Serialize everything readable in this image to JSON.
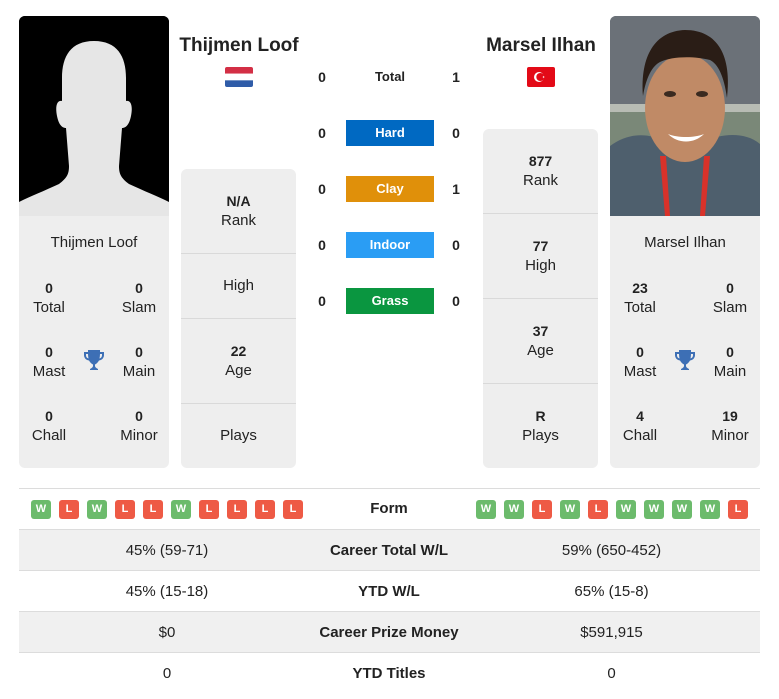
{
  "colors": {
    "hard": "#0069c2",
    "clay": "#e0900a",
    "indoor": "#2a9df4",
    "grass": "#0a9640",
    "win": "#6cbb6c",
    "loss": "#ee5a45",
    "trophy": "#3d6fb5"
  },
  "player1": {
    "name": "Thijmen Loof",
    "country_flag": "netherlands-flag",
    "photo": "silhouette-placeholder",
    "titles": {
      "total": {
        "value": "0",
        "label": "Total"
      },
      "slam": {
        "value": "0",
        "label": "Slam"
      },
      "mast": {
        "value": "0",
        "label": "Mast"
      },
      "main": {
        "value": "0",
        "label": "Main"
      },
      "chall": {
        "value": "0",
        "label": "Chall"
      },
      "minor": {
        "value": "0",
        "label": "Minor"
      }
    },
    "stats": [
      {
        "value": "N/A",
        "label": "Rank"
      },
      {
        "value": "",
        "label": "High"
      },
      {
        "value": "22",
        "label": "Age"
      },
      {
        "value": "",
        "label": "Plays"
      }
    ],
    "form": [
      "W",
      "L",
      "W",
      "L",
      "L",
      "W",
      "L",
      "L",
      "L",
      "L"
    ]
  },
  "player2": {
    "name": "Marsel Ilhan",
    "country_flag": "turkey-flag",
    "photo": "player-photo",
    "titles": {
      "total": {
        "value": "23",
        "label": "Total"
      },
      "slam": {
        "value": "0",
        "label": "Slam"
      },
      "mast": {
        "value": "0",
        "label": "Mast"
      },
      "main": {
        "value": "0",
        "label": "Main"
      },
      "chall": {
        "value": "4",
        "label": "Chall"
      },
      "minor": {
        "value": "19",
        "label": "Minor"
      }
    },
    "stats": [
      {
        "value": "877",
        "label": "Rank"
      },
      {
        "value": "77",
        "label": "High"
      },
      {
        "value": "37",
        "label": "Age"
      },
      {
        "value": "R",
        "label": "Plays"
      }
    ],
    "form": [
      "W",
      "W",
      "L",
      "W",
      "L",
      "W",
      "W",
      "W",
      "W",
      "L"
    ]
  },
  "h2h": [
    {
      "label": "Total",
      "p1": "0",
      "p2": "1",
      "surface": "total"
    },
    {
      "label": "Hard",
      "p1": "0",
      "p2": "0",
      "surface": "hard"
    },
    {
      "label": "Clay",
      "p1": "0",
      "p2": "1",
      "surface": "clay"
    },
    {
      "label": "Indoor",
      "p1": "0",
      "p2": "0",
      "surface": "indoor"
    },
    {
      "label": "Grass",
      "p1": "0",
      "p2": "0",
      "surface": "grass"
    }
  ],
  "table": {
    "form_label": "Form",
    "rows": [
      {
        "label": "Career Total W/L",
        "p1": "45% (59-71)",
        "p2": "59% (650-452)"
      },
      {
        "label": "YTD W/L",
        "p1": "45% (15-18)",
        "p2": "65% (15-8)"
      },
      {
        "label": "Career Prize Money",
        "p1": "$0",
        "p2": "$591,915"
      },
      {
        "label": "YTD Titles",
        "p1": "0",
        "p2": "0"
      }
    ]
  }
}
